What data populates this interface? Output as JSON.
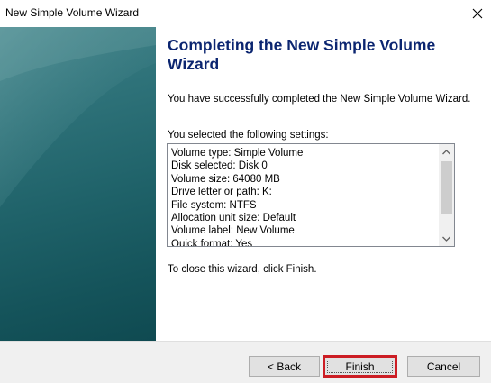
{
  "window": {
    "title": "New Simple Volume Wizard",
    "close_icon": "close-icon"
  },
  "main": {
    "heading": "Completing the New Simple Volume Wizard",
    "description": "You have successfully completed the New Simple Volume Wizard.",
    "settings_label": "You selected the following settings:",
    "settings": [
      "Volume type: Simple Volume",
      "Disk selected: Disk 0",
      "Volume size: 64080 MB",
      "Drive letter or path: K:",
      "File system: NTFS",
      "Allocation unit size: Default",
      "Volume label: New Volume",
      "Quick format: Yes"
    ],
    "close_hint": "To close this wizard, click Finish."
  },
  "buttons": {
    "back_label": "< Back",
    "finish_label": "Finish",
    "cancel_label": "Cancel"
  },
  "colors": {
    "heading": "#0b2570",
    "sidebar": "#1f6269",
    "finish_highlight": "#cc1d24"
  }
}
